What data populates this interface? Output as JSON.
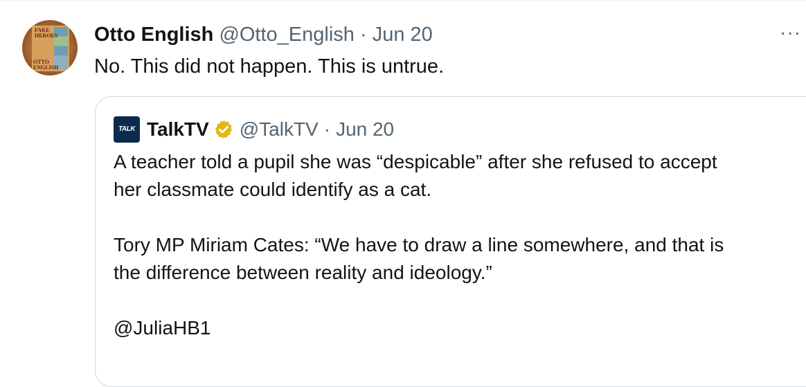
{
  "tweet": {
    "author_name": "Otto English",
    "author_handle": "@Otto_English",
    "separator": "·",
    "date": "Jun 20",
    "text": "No. This did not happen. This is untrue.",
    "more_label": "···",
    "avatar_text_top": "FAKE HEROES",
    "avatar_text_bottom": "OTTO ENGLISH"
  },
  "quote": {
    "logo_text": "TALK",
    "author_name": "TalkTV",
    "verified_icon": "gold-verified-badge-icon",
    "author_handle": "@TalkTV",
    "separator": "·",
    "date": "Jun 20",
    "lines": [
      "A teacher told a pupil she was “despicable” after she refused to accept",
      "her classmate could identify as a cat.",
      "Tory MP Miriam Cates: “We have to draw a line somewhere, and that is",
      "the difference between reality and ideology.”",
      "@JuliaHB1"
    ]
  },
  "colors": {
    "text_primary": "#0f1419",
    "text_secondary": "#536471",
    "border": "#cfd9de",
    "verified_gold": "#e2b719"
  }
}
